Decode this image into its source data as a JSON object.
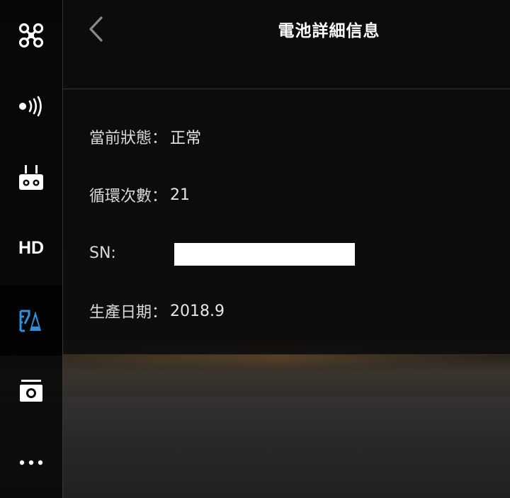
{
  "header": {
    "title": "電池詳細信息"
  },
  "sidebar": {
    "items": [
      {
        "name": "aircraft",
        "icon": "drone-icon"
      },
      {
        "name": "signal",
        "icon": "signal-broadcast-icon"
      },
      {
        "name": "remote-controller",
        "icon": "remote-controller-icon"
      },
      {
        "name": "hd-transmission",
        "label": "HD"
      },
      {
        "name": "battery",
        "icon": "battery-icon",
        "active": true
      },
      {
        "name": "camera",
        "icon": "camera-icon"
      },
      {
        "name": "more",
        "icon": "more-dots-icon"
      }
    ],
    "accent_color": "#2f8fe0"
  },
  "battery_info": {
    "status": {
      "label": "當前狀態",
      "value": "正常"
    },
    "cycles": {
      "label": "循環次數",
      "value": "21"
    },
    "serial": {
      "label": "SN"
    },
    "production_date": {
      "label": "生產日期",
      "value": "2018.9"
    },
    "separator_cjk": "：",
    "separator_latin": ":"
  }
}
